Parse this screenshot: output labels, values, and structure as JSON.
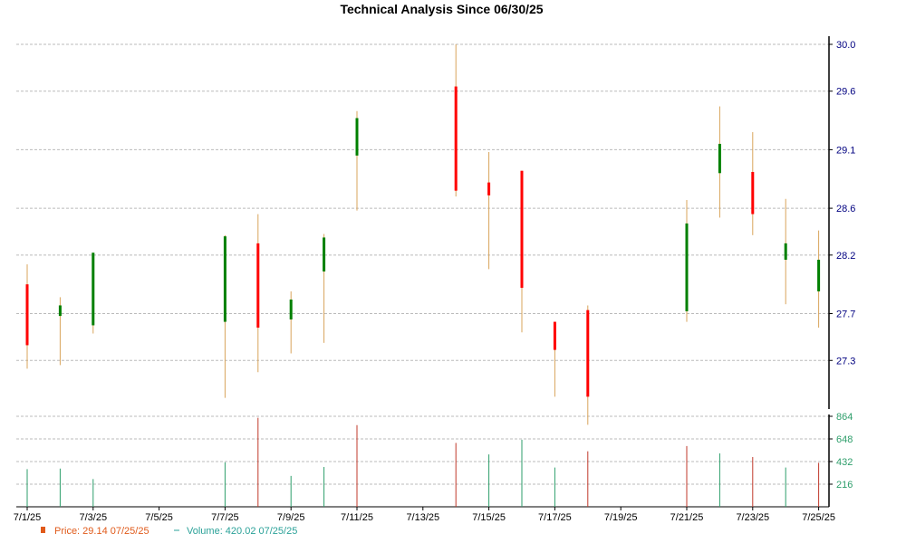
{
  "chart_data": {
    "type": "candlestick",
    "title": "Technical Analysis Since 06/30/25",
    "price_axis": {
      "ylim": [
        26.9,
        30.0
      ],
      "ticks": [
        "30.0",
        "29.6",
        "29.1",
        "28.6",
        "28.2",
        "27.7",
        "27.3"
      ],
      "tick_values": [
        30.0,
        29.6,
        29.1,
        28.6,
        28.2,
        27.7,
        27.3
      ],
      "side": "right"
    },
    "volume_axis": {
      "ylim": [
        0,
        864
      ],
      "ticks": [
        "864",
        "648",
        "432",
        "216"
      ],
      "tick_values": [
        864,
        648,
        432,
        216
      ],
      "side": "right"
    },
    "x_ticks": [
      "7/1/25",
      "7/3/25",
      "7/5/25",
      "7/7/25",
      "7/9/25",
      "7/11/25",
      "7/13/25",
      "7/15/25",
      "7/17/25",
      "7/19/25",
      "7/21/25",
      "7/23/25",
      "7/25/25"
    ],
    "colors": {
      "up": "#008000",
      "down": "#ff0000",
      "wick": "#d9a45b",
      "vol_up": "#2e9e6b",
      "vol_down": "#c0392b",
      "grid": "#bbbbbb",
      "axis_text": "#000080"
    },
    "candles": [
      {
        "date": "2025-07-01",
        "open": 27.95,
        "high": 28.12,
        "low": 27.23,
        "close": 27.43
      },
      {
        "date": "2025-07-02",
        "open": 27.68,
        "high": 27.84,
        "low": 27.26,
        "close": 27.77
      },
      {
        "date": "2025-07-03",
        "open": 27.6,
        "high": 28.22,
        "low": 27.53,
        "close": 28.22
      },
      {
        "date": "2025-07-07",
        "open": 27.63,
        "high": 28.37,
        "low": 26.98,
        "close": 28.36
      },
      {
        "date": "2025-07-08",
        "open": 28.3,
        "high": 28.55,
        "low": 27.2,
        "close": 27.58
      },
      {
        "date": "2025-07-09",
        "open": 27.65,
        "high": 27.89,
        "low": 27.36,
        "close": 27.82
      },
      {
        "date": "2025-07-10",
        "open": 28.06,
        "high": 28.38,
        "low": 27.45,
        "close": 28.35
      },
      {
        "date": "2025-07-11",
        "open": 29.05,
        "high": 29.43,
        "low": 28.58,
        "close": 29.37
      },
      {
        "date": "2025-07-14",
        "open": 29.64,
        "high": 30.0,
        "low": 28.7,
        "close": 28.75
      },
      {
        "date": "2025-07-15",
        "open": 28.82,
        "high": 29.08,
        "low": 28.08,
        "close": 28.71
      },
      {
        "date": "2025-07-16",
        "open": 28.92,
        "high": 28.92,
        "low": 27.54,
        "close": 27.92
      },
      {
        "date": "2025-07-17",
        "open": 27.63,
        "high": 27.63,
        "low": 26.99,
        "close": 27.39
      },
      {
        "date": "2025-07-18",
        "open": 27.73,
        "high": 27.77,
        "low": 26.75,
        "close": 26.99
      },
      {
        "date": "2025-07-21",
        "open": 27.72,
        "high": 28.67,
        "low": 27.63,
        "close": 28.47
      },
      {
        "date": "2025-07-22",
        "open": 28.9,
        "high": 29.47,
        "low": 28.52,
        "close": 29.15
      },
      {
        "date": "2025-07-23",
        "open": 28.91,
        "high": 29.25,
        "low": 28.37,
        "close": 28.55
      },
      {
        "date": "2025-07-24",
        "open": 28.16,
        "high": 28.68,
        "low": 27.78,
        "close": 28.3
      },
      {
        "date": "2025-07-25",
        "open": 27.89,
        "high": 28.41,
        "low": 27.58,
        "close": 28.16
      }
    ],
    "volume": [
      {
        "date": "2025-07-01",
        "value": 360,
        "dir": "up"
      },
      {
        "date": "2025-07-02",
        "value": 365,
        "dir": "up"
      },
      {
        "date": "2025-07-03",
        "value": 265,
        "dir": "up"
      },
      {
        "date": "2025-07-07",
        "value": 425,
        "dir": "up"
      },
      {
        "date": "2025-07-08",
        "value": 850,
        "dir": "down"
      },
      {
        "date": "2025-07-09",
        "value": 295,
        "dir": "up"
      },
      {
        "date": "2025-07-10",
        "value": 380,
        "dir": "up"
      },
      {
        "date": "2025-07-11",
        "value": 780,
        "dir": "down"
      },
      {
        "date": "2025-07-14",
        "value": 610,
        "dir": "down"
      },
      {
        "date": "2025-07-15",
        "value": 500,
        "dir": "up"
      },
      {
        "date": "2025-07-16",
        "value": 640,
        "dir": "up"
      },
      {
        "date": "2025-07-17",
        "value": 375,
        "dir": "up"
      },
      {
        "date": "2025-07-18",
        "value": 530,
        "dir": "down"
      },
      {
        "date": "2025-07-21",
        "value": 580,
        "dir": "down"
      },
      {
        "date": "2025-07-22",
        "value": 510,
        "dir": "up"
      },
      {
        "date": "2025-07-23",
        "value": 475,
        "dir": "down"
      },
      {
        "date": "2025-07-24",
        "value": 375,
        "dir": "up"
      },
      {
        "date": "2025-07-25",
        "value": 420,
        "dir": "down"
      }
    ],
    "legend": {
      "price_label": "Price: 29.14  07/25/25",
      "volume_label": "Volume: 420.02  07/25/25",
      "price_color": "#e05a1a",
      "volume_color": "#2aa198"
    }
  }
}
